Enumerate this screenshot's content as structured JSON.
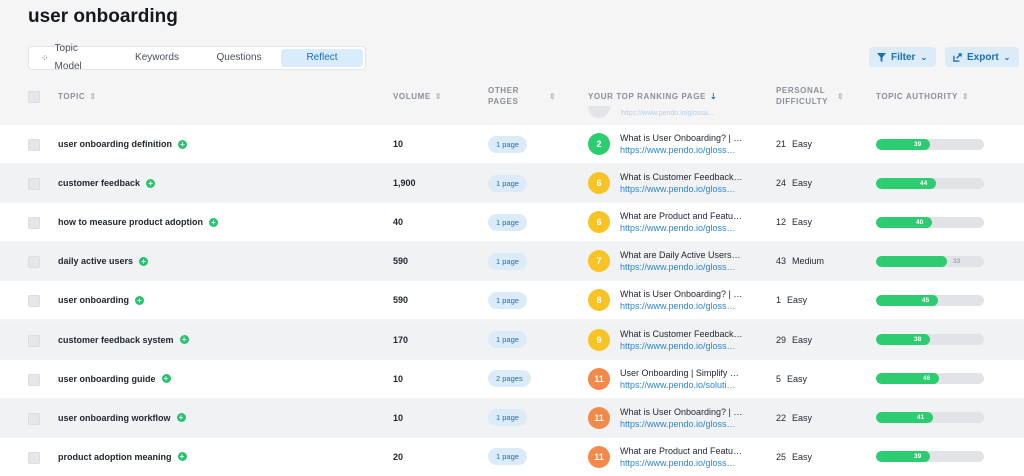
{
  "page": {
    "title": "user onboarding"
  },
  "tabs": [
    {
      "label": "Topic Model",
      "active": false
    },
    {
      "label": "Keywords",
      "active": false
    },
    {
      "label": "Questions",
      "active": false
    },
    {
      "label": "Reflect",
      "active": true
    }
  ],
  "actions": {
    "filter_label": "Filter",
    "export_label": "Export"
  },
  "columns": {
    "topic": "TOPIC",
    "volume": "VOLUME",
    "other_pages_line1": "OTHER",
    "other_pages_line2": "PAGES",
    "top_ranking": "YOUR TOP RANKING PAGE",
    "difficulty_line1": "PERSONAL",
    "difficulty_line2": "DIFFICULTY",
    "authority": "TOPIC AUTHORITY"
  },
  "ghost_row": {
    "url": "https://www.pendo.io/glossa..."
  },
  "rows": [
    {
      "topic": "user onboarding definition",
      "volume": "10",
      "pages": "1 page",
      "rank": "2",
      "rank_color": "#2ecc71",
      "page_title": "What is User Onboarding? | …",
      "page_url": "https://www.pendo.io/gloss…",
      "difficulty": "21",
      "difficulty_label": "Easy",
      "authority": 39,
      "authority_level": 0.5
    },
    {
      "topic": "customer feedback",
      "volume": "1,900",
      "pages": "1 page",
      "rank": "6",
      "rank_color": "#f7c325",
      "page_title": "What is Customer Feedback…",
      "page_url": "https://www.pendo.io/gloss…",
      "difficulty": "24",
      "difficulty_label": "Easy",
      "authority": 44,
      "authority_level": 0.56
    },
    {
      "topic": "how to measure product adoption",
      "volume": "40",
      "pages": "1 page",
      "rank": "6",
      "rank_color": "#f7c325",
      "page_title": "What are Product and Featu…",
      "page_url": "https://www.pendo.io/gloss…",
      "difficulty": "12",
      "difficulty_label": "Easy",
      "authority": 40,
      "authority_level": 0.52
    },
    {
      "topic": "daily active users",
      "volume": "590",
      "pages": "1 page",
      "rank": "7",
      "rank_color": "#f7c325",
      "page_title": "What are Daily Active Users…",
      "page_url": "https://www.pendo.io/gloss…",
      "difficulty": "43",
      "difficulty_label": "Medium",
      "authority": 33,
      "authority_level": 0.66,
      "label_outside": true
    },
    {
      "topic": "user onboarding",
      "volume": "590",
      "pages": "1 page",
      "rank": "8",
      "rank_color": "#f7c325",
      "page_title": "What is User Onboarding? | …",
      "page_url": "https://www.pendo.io/gloss…",
      "difficulty": "1",
      "difficulty_label": "Easy",
      "authority": 45,
      "authority_level": 0.57
    },
    {
      "topic": "customer feedback system",
      "volume": "170",
      "pages": "1 page",
      "rank": "9",
      "rank_color": "#f7c325",
      "page_title": "What is Customer Feedback…",
      "page_url": "https://www.pendo.io/gloss…",
      "difficulty": "29",
      "difficulty_label": "Easy",
      "authority": 38,
      "authority_level": 0.5
    },
    {
      "topic": "user onboarding guide",
      "volume": "10",
      "pages": "2 pages",
      "rank": "11",
      "rank_color": "#f4894a",
      "page_title": "User Onboarding | Simplify …",
      "page_url": "https://www.pendo.io/soluti…",
      "difficulty": "5",
      "difficulty_label": "Easy",
      "authority": 46,
      "authority_level": 0.58
    },
    {
      "topic": "user onboarding workflow",
      "volume": "10",
      "pages": "1 page",
      "rank": "11",
      "rank_color": "#f4894a",
      "page_title": "What is User Onboarding? | …",
      "page_url": "https://www.pendo.io/gloss…",
      "difficulty": "22",
      "difficulty_label": "Easy",
      "authority": 41,
      "authority_level": 0.53
    },
    {
      "topic": "product adoption meaning",
      "volume": "20",
      "pages": "1 page",
      "rank": "11",
      "rank_color": "#f4894a",
      "page_title": "What are Product and Featu…",
      "page_url": "https://www.pendo.io/gloss…",
      "difficulty": "25",
      "difficulty_label": "Easy",
      "authority": 39,
      "authority_level": 0.5
    }
  ]
}
